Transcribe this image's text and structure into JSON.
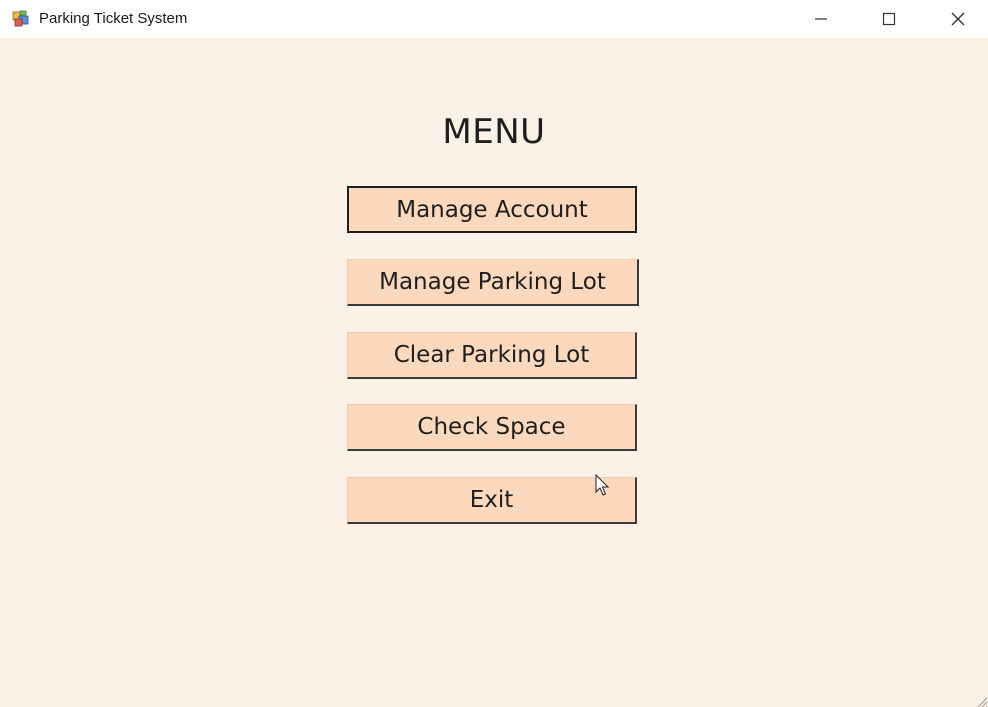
{
  "window": {
    "title": "Parking Ticket System",
    "icon": "application-form-icon",
    "controls": {
      "minimize_icon": "minimize-icon",
      "maximize_icon": "maximize-icon",
      "close_icon": "close-icon"
    }
  },
  "menu": {
    "title": "MENU",
    "buttons": [
      {
        "label": "Manage Account"
      },
      {
        "label": "Manage Parking Lot"
      },
      {
        "label": "Clear Parking Lot"
      },
      {
        "label": "Check Space"
      },
      {
        "label": "Exit"
      }
    ]
  },
  "colors": {
    "background": "#fbf1e7",
    "button_fill": "#fcd9bc",
    "titlebar": "#ffffff",
    "text": "#1e1e1e"
  }
}
